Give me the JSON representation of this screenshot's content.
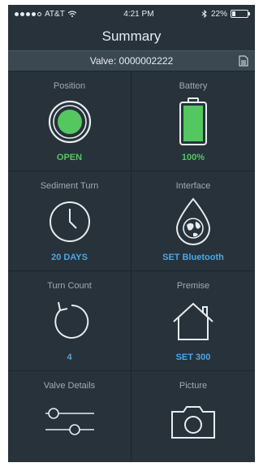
{
  "status_bar": {
    "carrier": "AT&T",
    "time": "4:21 PM",
    "battery": "22%",
    "battery_level": 0.22
  },
  "header": {
    "title": "Summary"
  },
  "valve_bar": {
    "label": "Valve: 0000002222"
  },
  "tiles": [
    {
      "label": "Position",
      "value": "OPEN",
      "icon": "position-indicator-icon",
      "value_color": "#54c760"
    },
    {
      "label": "Battery",
      "value": "100%",
      "icon": "battery-icon",
      "value_color": "#54c760",
      "level": 1.0
    },
    {
      "label": "Sediment Turn",
      "value": "20 DAYS",
      "icon": "clock-icon",
      "value_color": "#4aa7e6"
    },
    {
      "label": "Interface",
      "value": "SET Bluetooth",
      "icon": "globe-drop-icon",
      "value_color": "#4aa7e6"
    },
    {
      "label": "Turn Count",
      "value": "4",
      "icon": "refresh-icon",
      "value_color": "#4aa7e6"
    },
    {
      "label": "Premise",
      "value": "SET 300",
      "icon": "house-icon",
      "value_color": "#4aa7e6"
    },
    {
      "label": "Valve Details",
      "value": "",
      "icon": "sliders-icon"
    },
    {
      "label": "Picture",
      "value": "",
      "icon": "camera-icon"
    }
  ],
  "colors": {
    "background": "#27323b",
    "panel": "#3b4852",
    "accent_green": "#54c760",
    "accent_blue": "#4aa7e6"
  }
}
